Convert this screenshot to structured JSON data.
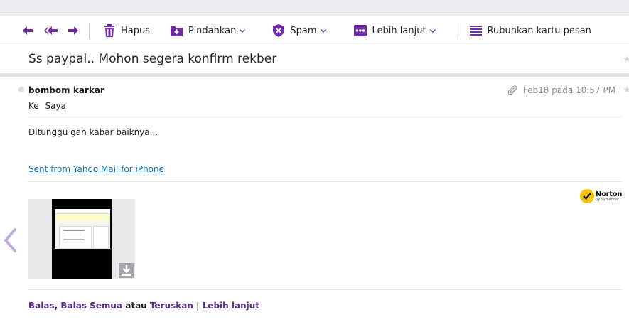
{
  "toolbar": {
    "delete_label": "Hapus",
    "move_label": "Pindahkan",
    "spam_label": "Spam",
    "more_label": "Lebih lanjut",
    "compact_label": "Rubuhkan kartu pesan"
  },
  "message": {
    "subject": "Ss paypal.. Mohon segera konfirm rekber",
    "sender": "bombom karkar",
    "to_prefix": "Ke",
    "to_name": "Saya",
    "date": "Feb18 pada 10:57 PM",
    "body": "Ditunggu gan kabar baiknya...",
    "signature_link": "Sent from Yahoo Mail for iPhone"
  },
  "norton": {
    "name": "Norton",
    "by": "by Symantec"
  },
  "reply": {
    "reply": "Balas",
    "comma": ",",
    "reply_all": "Balas Semua",
    "or": "atau",
    "forward": "Teruskan",
    "pipe": "|",
    "more": "Lebih lanjut"
  },
  "colors": {
    "accent": "#6e2ba5",
    "link": "#1a6fb3",
    "reply_link": "#5b2d8e"
  },
  "icons": [
    "reply-icon",
    "reply-all-icon",
    "forward-icon",
    "trash-icon",
    "move-folder-icon",
    "spam-shield-icon",
    "more-dots-icon",
    "list-icon",
    "paperclip-icon",
    "download-icon",
    "back-chevron-icon"
  ]
}
